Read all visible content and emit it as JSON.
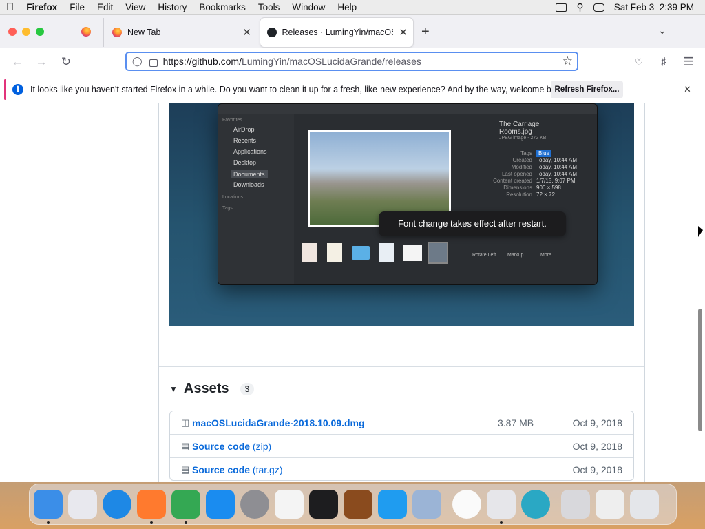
{
  "menubar": {
    "app": "Firefox",
    "items": [
      "File",
      "Edit",
      "View",
      "History",
      "Bookmarks",
      "Tools",
      "Window",
      "Help"
    ],
    "datetime": "Sat Feb 3  2:39 PM"
  },
  "tabs": [
    {
      "label": "New Tab"
    },
    {
      "label": "Releases · LumingYin/macOSLu"
    }
  ],
  "url": {
    "host": "https://github.com/",
    "path": "LumingYin/macOSLucidaGrande/releases"
  },
  "notification": {
    "message": "It looks like you haven't started Firefox in a while. Do you want to clean it up for a fresh, like-new experience? And by the way, welcome back!",
    "button": "Refresh Firefox..."
  },
  "screenshot": {
    "sidebar_heading_favorites": "Favorites",
    "sidebar_items": [
      "AirDrop",
      "Recents",
      "Applications",
      "Desktop",
      "Documents",
      "Downloads"
    ],
    "sidebar_heading_locations": "Locations",
    "sidebar_heading_tags": "Tags",
    "file_name": "The Carriage Rooms.jpg",
    "file_kind": "JPEG image - 272 KB",
    "info_rows": [
      {
        "k": "Tags",
        "v": "Blue"
      },
      {
        "k": "Created",
        "v": "Today, 10:44 AM"
      },
      {
        "k": "Modified",
        "v": "Today, 10:44 AM"
      },
      {
        "k": "Last opened",
        "v": "Today, 10:44 AM"
      },
      {
        "k": "Content created",
        "v": "1/7/15, 9:07 PM"
      },
      {
        "k": "Dimensions",
        "v": "900 × 598"
      },
      {
        "k": "Resolution",
        "v": "72 × 72"
      }
    ],
    "actions": [
      "Rotate Left",
      "Markup",
      "More..."
    ]
  },
  "tooltip": "Font change takes effect after restart.",
  "assets": {
    "title": "Assets",
    "count": "3",
    "rows": [
      {
        "name": "macOSLucidaGrande-2018.10.09.dmg",
        "suffix": "",
        "size": "3.87 MB",
        "date": "Oct 9, 2018",
        "icon": "package-icon"
      },
      {
        "name": "Source code",
        "suffix": " (zip)",
        "size": "",
        "date": "Oct 9, 2018",
        "icon": "file-zip-icon"
      },
      {
        "name": "Source code",
        "suffix": " (tar.gz)",
        "size": "",
        "date": "Oct 9, 2018",
        "icon": "file-zip-icon"
      }
    ]
  },
  "dock": {
    "apps": [
      "finder",
      "launchpad",
      "safari",
      "firefox",
      "chrome",
      "app-store",
      "system-preferences",
      "textedit",
      "terminal",
      "instruments",
      "vscode",
      "migration-assistant",
      "clock",
      "system-information",
      "typeface",
      "fonts",
      "documents",
      "trash"
    ],
    "colors": {
      "finder": "#3b8ee8",
      "launchpad": "#e8e8ee",
      "safari": "#1e88e5",
      "firefox": "#ff7a2e",
      "chrome": "#34a853",
      "app-store": "#1a8cf0",
      "system-preferences": "#8e8e93",
      "textedit": "#f4f4f4",
      "terminal": "#1d1d1f",
      "instruments": "#8a4b1e",
      "vscode": "#1f9cf0",
      "migration-assistant": "#9bb4d6",
      "clock": "#fafafa",
      "system-information": "#e6e6ea",
      "typeface": "#2aa8c4",
      "fonts": "#d8d8dc",
      "documents": "#eeeeee",
      "trash": "#e4e6ea"
    }
  }
}
